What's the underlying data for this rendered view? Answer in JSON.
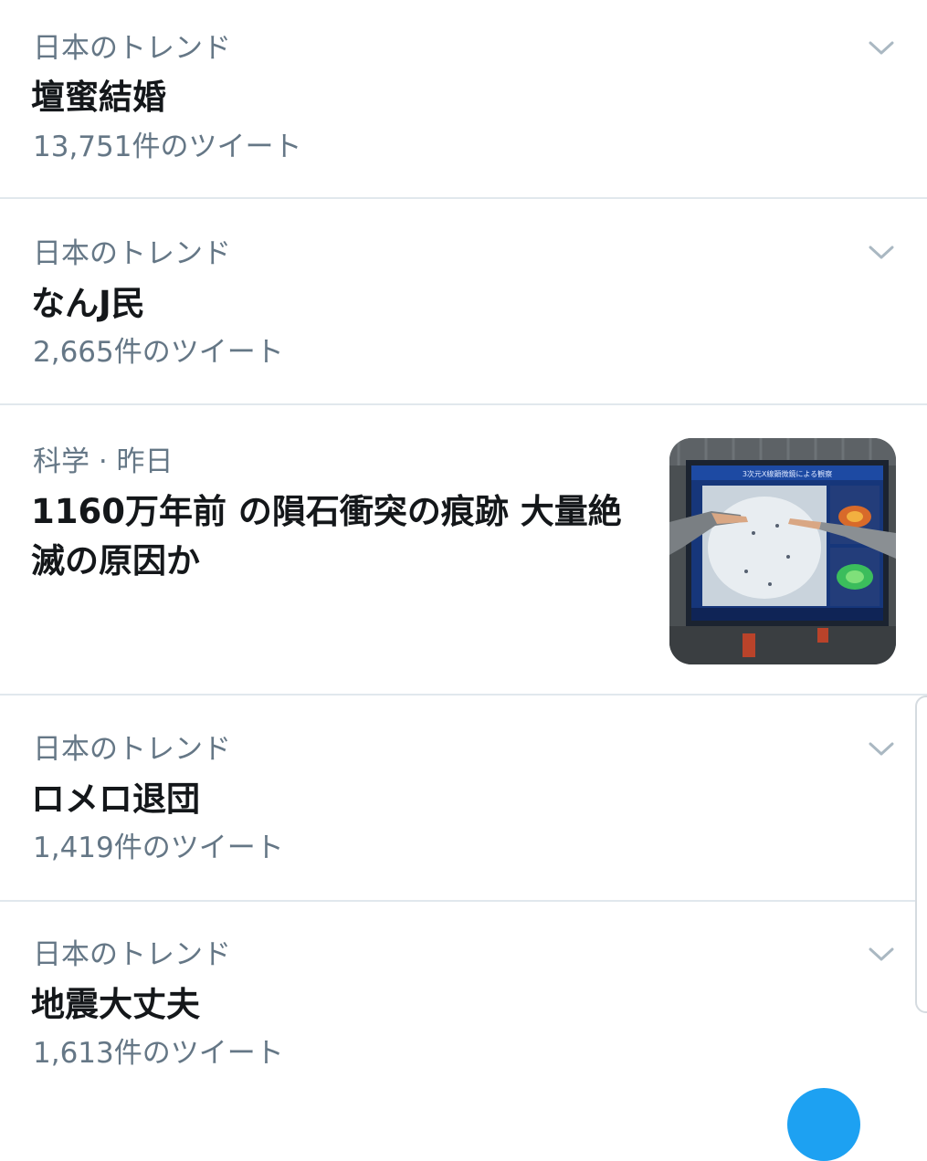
{
  "trends": [
    {
      "context": "日本のトレンド",
      "title": "壇蜜結婚",
      "count": "13,751件のツイート"
    },
    {
      "context": "日本のトレンド",
      "title": "なんJ民",
      "count": "2,665件のツイート"
    },
    {
      "context": "科学 · 昨日",
      "title": "1160万年前 の隕石衝突の痕跡 大量絶滅の原因か",
      "thumbnail_screen_title": "3次元X線顕微鏡による観察"
    },
    {
      "context": "日本のトレンド",
      "title": "ロメロ退団",
      "count": "1,419件のツイート"
    },
    {
      "context": "日本のトレンド",
      "title": "地震大丈夫",
      "count": "1,613件のツイート"
    }
  ],
  "icons": {
    "menu_caret": "chevron-down-icon"
  },
  "colors": {
    "primary_text": "#14171a",
    "secondary_text": "#657786",
    "divider": "#e1e8ed",
    "accent": "#1da1f2"
  }
}
